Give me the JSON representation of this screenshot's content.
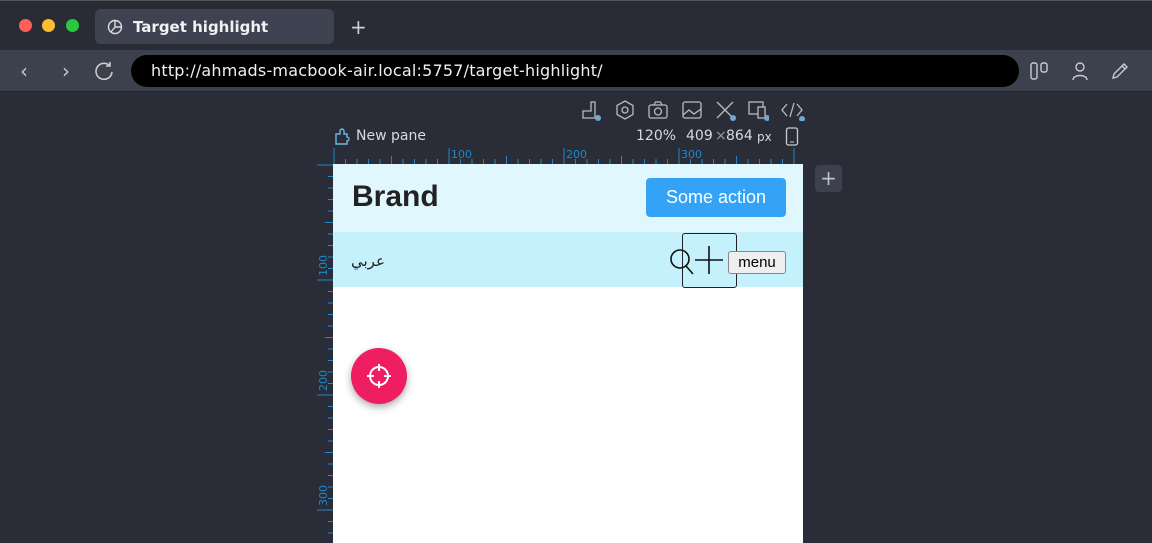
{
  "browser": {
    "tab_title": "Target highlight",
    "new_tab_label": "+",
    "url": "http://ahmads-macbook-air.local:5757/target-highlight/"
  },
  "pane": {
    "name": "New pane",
    "zoom": "120%",
    "width": "409",
    "times": "×",
    "height": "864",
    "unit": "px",
    "add_label": "+"
  },
  "rulers": {
    "top_labels": [
      "100",
      "200",
      "300"
    ],
    "left_labels": [
      "100",
      "200",
      "300"
    ]
  },
  "page": {
    "brand": "Brand",
    "action_label": "Some action",
    "language_link": "عربي",
    "menu_label": "menu"
  },
  "colors": {
    "accent": "#34a3f5",
    "fab": "#ef1e63",
    "header_bg": "#dff7fd",
    "nav_bg": "#c5f1fc",
    "ruler": "#1e88c8"
  }
}
